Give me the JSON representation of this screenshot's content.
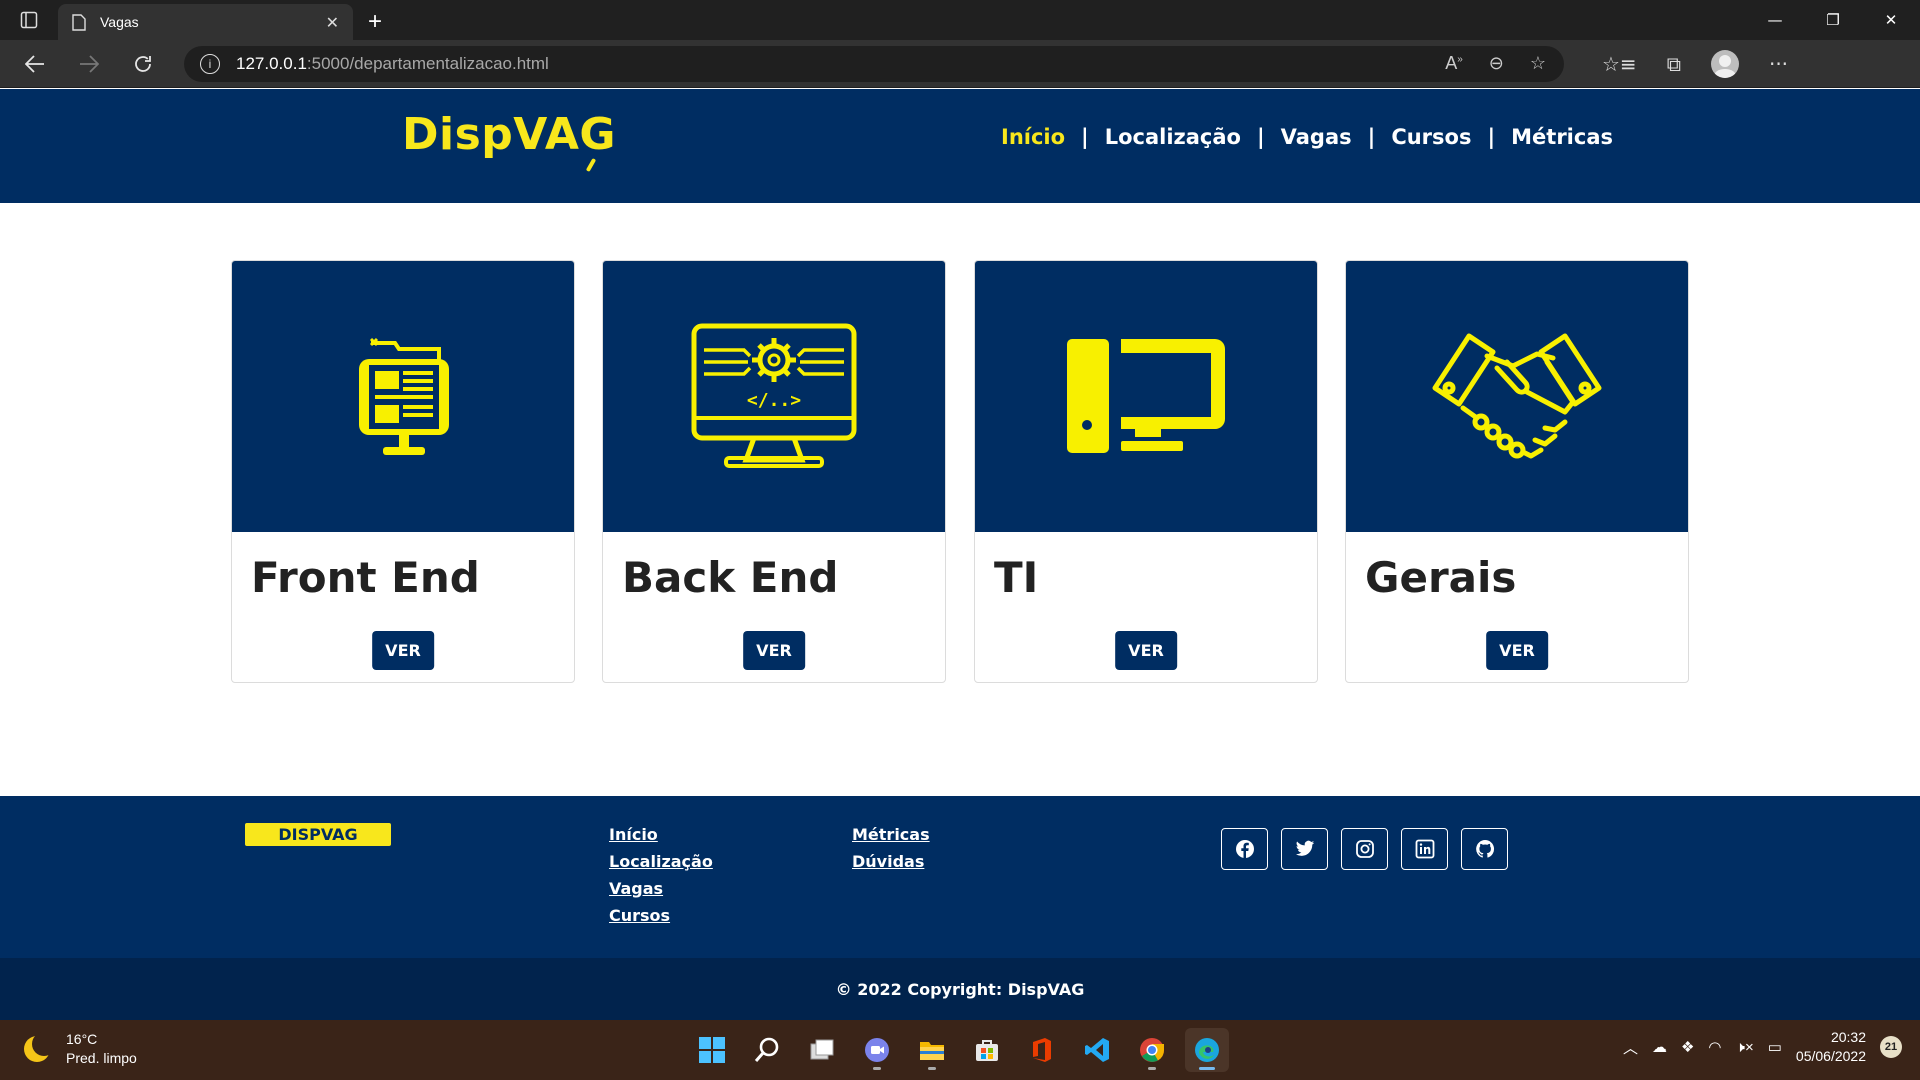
{
  "browser": {
    "tab_title": "Vagas",
    "url_host": "127.0.0.1",
    "url_path": ":5000/departamentalizacao.html"
  },
  "header": {
    "logo": "DispVA",
    "logo_last": "G",
    "nav": [
      {
        "label": "Início",
        "active": true
      },
      {
        "label": "Localização",
        "active": false
      },
      {
        "label": "Vagas",
        "active": false
      },
      {
        "label": "Cursos",
        "active": false
      },
      {
        "label": "Métricas",
        "active": false
      }
    ],
    "separator": "|"
  },
  "cards": [
    {
      "title": "Front End",
      "button": "VER",
      "icon": "web-page-monitor-icon"
    },
    {
      "title": "Back End",
      "button": "VER",
      "icon": "code-gear-monitor-icon"
    },
    {
      "title": "TI",
      "button": "VER",
      "icon": "desktop-computer-icon"
    },
    {
      "title": "Gerais",
      "button": "VER",
      "icon": "handshake-icon"
    }
  ],
  "footer": {
    "brand": "DISPVAG",
    "col1": [
      "Início",
      "Localização",
      "Vagas",
      "Cursos"
    ],
    "col2": [
      "Métricas",
      "Dúvidas"
    ],
    "social": [
      "facebook-icon",
      "twitter-icon",
      "instagram-icon",
      "linkedin-icon",
      "github-icon"
    ],
    "copyright": "© 2022 Copyright: DispVAG"
  },
  "taskbar": {
    "temperature": "16°C",
    "weather": "Pred. limpo",
    "time": "20:32",
    "date": "05/06/2022",
    "notifications": "21"
  },
  "colors": {
    "navy": "#002d62",
    "yellow": "#f8e71c",
    "dark_footer": "#01234d"
  }
}
